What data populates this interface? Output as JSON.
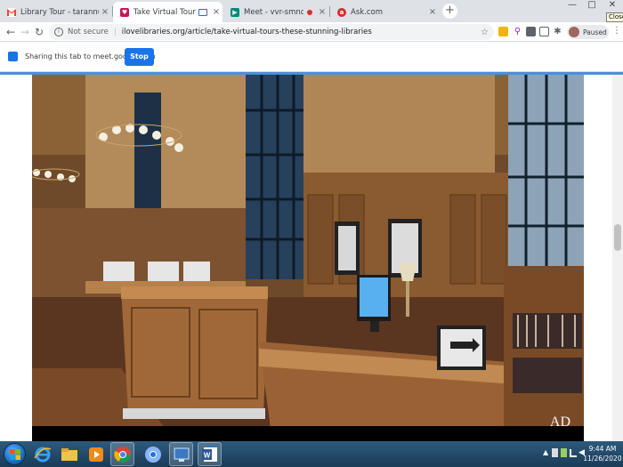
{
  "tabs": [
    {
      "title": "Library Tour - tarannum@theind",
      "icon": "gmail-icon",
      "color": "#ea4335"
    },
    {
      "title": "Take Virtual Tours of These S",
      "icon": "ilovelibraries-icon",
      "color": "#c2185b",
      "active": true
    },
    {
      "title": "Meet - vvr-smnq-mce",
      "icon": "meet-icon",
      "color": "#00897b"
    },
    {
      "title": "Ask.com",
      "icon": "ask-icon",
      "color": "#d32f2f"
    }
  ],
  "tab_close_symbol": "×",
  "new_tab_symbol": "+",
  "window_controls": {
    "minimize": "—",
    "maximize": "□",
    "close": "✕",
    "tooltip": "Close"
  },
  "address": {
    "security_text": "Not secure",
    "url": "ilovelibraries.org/article/take-virtual-tours-these-stunning-libraries"
  },
  "profile": {
    "label": "Paused"
  },
  "sharing": {
    "text": "Sharing this tab to meet.google.com",
    "stop_label": "Stop"
  },
  "video": {
    "watermark": "AD"
  },
  "clock": {
    "time": "9:44 AM",
    "date": "11/26/2020"
  },
  "colors": {
    "accent": "#1a73e8",
    "taskbar": "#1f4566"
  }
}
